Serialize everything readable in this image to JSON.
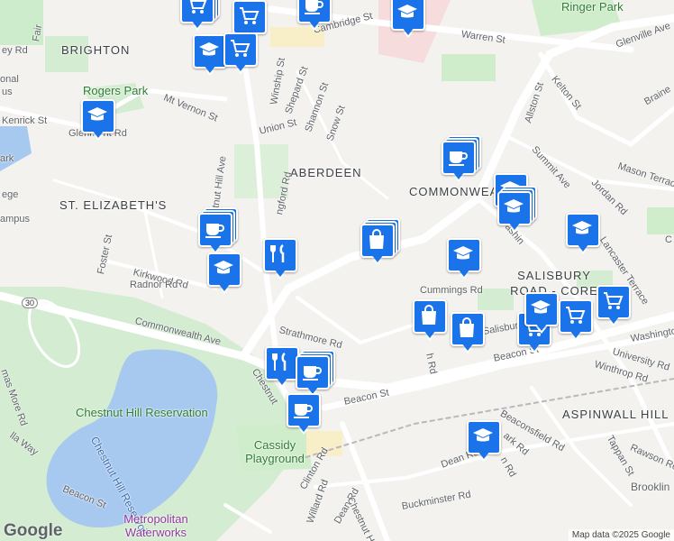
{
  "map": {
    "neighborhoods": [
      "BRIGHTON",
      "ABERDEEN",
      "ST. ELIZABETH'S",
      "COMMONWEALTH",
      "SALISBURY ROAD - CORE FARM",
      "ASPINWALL HILL"
    ],
    "parks": [
      "Rogers Park",
      "Ringer Park",
      "Cassidy Playground",
      "Chestnut Hill Reservation"
    ],
    "water": [
      "Chestnut Hill Reservoir"
    ],
    "landmark": "Metropolitan Waterworks Museum",
    "streets": {
      "cambridge": "Cambridge St",
      "warren": "Warren St",
      "glenville": "Glenville Ave",
      "kelton": "Kelton St",
      "allston": "Allston St",
      "summit": "Summit Ave",
      "mason": "Mason Terrace",
      "jordan": "Jordan Rd",
      "brainerd": "Braine",
      "mtvernon": "Mt Vernon St",
      "kenrick": "Kenrick St",
      "glenmont": "Glenmont Rd",
      "winship": "Winship St",
      "shepard": "Shepard St",
      "shannon": "Shannon St",
      "snow": "Snow St",
      "union": "Union St",
      "chestnuthillave": "Chestnut Hill Ave",
      "langford": "ngford Rd",
      "kirkwood": "Kirkwood Rd",
      "radnor": "Radnor Rd",
      "foster": "Foster St",
      "commonwealth": "Commonwealth Ave",
      "strathmore": "Strathmore Rd",
      "chestnutst": "Chestnut",
      "beacon1": "Beacon St",
      "beacon2": "Beacon St",
      "beacon3": "Beacon St",
      "cummings": "Cummings Rd",
      "washington": "Washington St",
      "washington2": "Washin",
      "university": "University Rd",
      "winthrop": "Winthrop Rd",
      "lancaster": "Lancaster Terrace",
      "beaconsfield": "Beaconsfield Rd",
      "tappan": "Tappan St",
      "rawson": "Rawson Ro",
      "dean": "Dean Rd",
      "dean2": "Dean Rd",
      "clinton": "Clinton Rd",
      "buckminster": "Buckminster Rd",
      "willard": "Willard Rd",
      "thomasmore": "mas More Rd",
      "ellaway": "lla Way",
      "salisbury": "Salisbur",
      "rd30": "30",
      "brooklin": "Brooklin",
      "hrd": "h Rd",
      "ark": "ark Rd",
      "eyrd": "ey Rd",
      "fair": "Fair",
      "onal": "onal",
      "us": "us",
      "ege": "ege",
      "ampus": "ampus",
      "ark2": "ark",
      "beac": "Bea",
      "c": "C",
      "nrd": "n Rd",
      "rd2": "Rd",
      "ave2": "Ave",
      "ave3": "Ave",
      "st2": "St",
      "hrd2": "h Rd"
    },
    "attribution": "Map data ©2025 Google",
    "logo": "Google"
  },
  "pins": [
    {
      "type": "shopping-cart",
      "stack": 2
    },
    {
      "type": "shopping-cart",
      "stack": 1
    },
    {
      "type": "education",
      "stack": 1
    },
    {
      "type": "coffee",
      "stack": 1
    },
    {
      "type": "education",
      "stack": 1
    },
    {
      "type": "education",
      "stack": 1
    },
    {
      "type": "shopping-cart",
      "stack": 1
    },
    {
      "type": "education",
      "stack": 1
    },
    {
      "type": "coffee",
      "stack": 2
    },
    {
      "type": "coffee",
      "stack": 2
    },
    {
      "type": "education",
      "stack": 1
    },
    {
      "type": "restaurant",
      "stack": 1
    },
    {
      "type": "shopping-bag",
      "stack": 2
    },
    {
      "type": "education",
      "stack": 2
    },
    {
      "type": "education",
      "stack": 1
    },
    {
      "type": "education",
      "stack": 1
    },
    {
      "type": "shopping-bag",
      "stack": 1
    },
    {
      "type": "shopping-bag",
      "stack": 1
    },
    {
      "type": "shopping-cart",
      "stack": 1
    },
    {
      "type": "education",
      "stack": 1
    },
    {
      "type": "shopping-cart",
      "stack": 1
    },
    {
      "type": "shopping-cart",
      "stack": 1
    },
    {
      "type": "restaurant",
      "stack": 1
    },
    {
      "type": "coffee",
      "stack": 2
    },
    {
      "type": "coffee",
      "stack": 1
    },
    {
      "type": "education",
      "stack": 1
    }
  ]
}
